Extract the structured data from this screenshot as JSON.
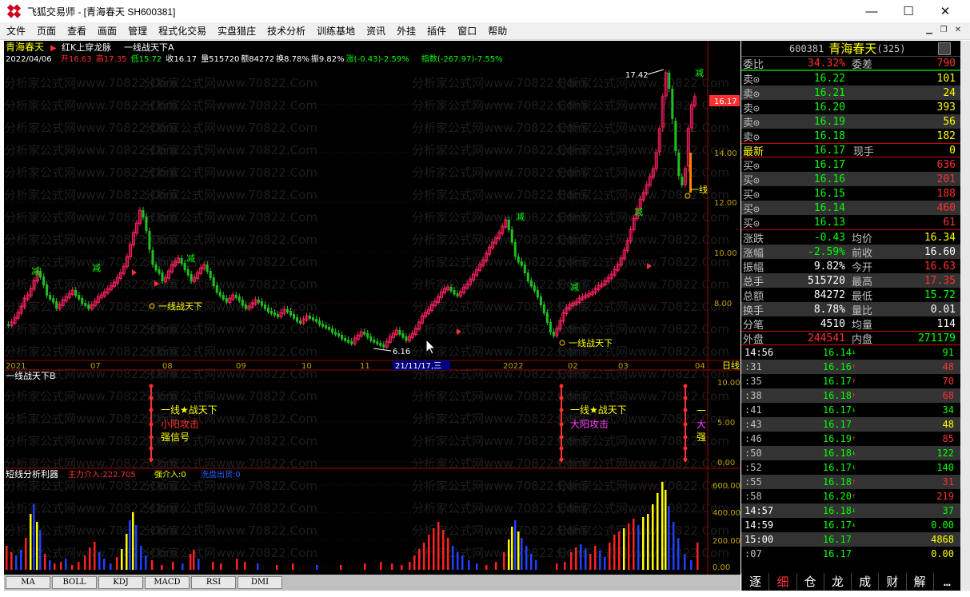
{
  "window": {
    "title": "飞狐交易师 - [青海春天 SH600381]"
  },
  "menu": [
    "文件",
    "页面",
    "查看",
    "画面",
    "管理",
    "程式化交易",
    "实盘猎庄",
    "技术分析",
    "训练基地",
    "资讯",
    "外挂",
    "插件",
    "窗口",
    "帮助"
  ],
  "chart_header": {
    "stock": "青海春天",
    "indicator1": "红K上穿龙脉",
    "indicator2": "一线战天下A",
    "date": "2022/04/06",
    "open": "开16.63",
    "high": "高17.35",
    "low": "低15.72",
    "close": "收16.17",
    "vol": "量515720",
    "amt": "额84272",
    "turnover": "换8.78%",
    "amp": "振9.82%",
    "change": "涨(-0.43)-2.59%",
    "index": "指数(-267.97)-7.55%"
  },
  "watermark": "分析家公式网www.70822.Com",
  "main_axis": [
    "16.17",
    "14.00",
    "12.00",
    "10.00",
    "8.00"
  ],
  "annotations": {
    "high": "17.42",
    "low": "6.16",
    "cursor_date": "21/11/17,三",
    "line_war": "一线战天下",
    "line_war_short": "一线",
    "reduce": "减"
  },
  "x_labels": [
    "2021",
    "07",
    "08",
    "09",
    "10",
    "11",
    "2022",
    "02",
    "03",
    "04"
  ],
  "period": "日线",
  "sub1": {
    "title": "一线战天下B",
    "axis": [
      "10.00",
      "5.00",
      "0.00"
    ],
    "labels": {
      "a": "一线★战天下",
      "b": "小阳攻击",
      "c": "强信号",
      "d": "大阳攻击",
      "e": "大",
      "f": "强"
    }
  },
  "sub2": {
    "title": "短线分析利器",
    "main": "主力介入:222.705",
    "strong": "强介入:0",
    "wash": "洗盘出货:0",
    "axis": [
      "600.00",
      "400.00",
      "200.00",
      "0.00"
    ]
  },
  "bottom_tabs": [
    "MA",
    "BOLL",
    "KDJ",
    "MACD",
    "RSI",
    "DMI"
  ],
  "quote": {
    "code": "600381",
    "name": "青海春天",
    "extra": "(325)",
    "weibi": {
      "label": "委比",
      "value": "34.32%",
      "label2": "委差",
      "value2": "790"
    },
    "asks": [
      {
        "l": "卖⊙",
        "p": "16.22",
        "v": "101"
      },
      {
        "l": "卖⊙",
        "p": "16.21",
        "v": "24"
      },
      {
        "l": "卖⊙",
        "p": "16.20",
        "v": "393"
      },
      {
        "l": "卖⊙",
        "p": "16.19",
        "v": "56"
      },
      {
        "l": "卖⊙",
        "p": "16.18",
        "v": "182"
      }
    ],
    "last": {
      "l": "最新",
      "p": "16.17",
      "l2": "现手",
      "v": "0"
    },
    "bids": [
      {
        "l": "买⊙",
        "p": "16.17",
        "v": "636"
      },
      {
        "l": "买⊙",
        "p": "16.16",
        "v": "201"
      },
      {
        "l": "买⊙",
        "p": "16.15",
        "v": "188"
      },
      {
        "l": "买⊙",
        "p": "16.14",
        "v": "460"
      },
      {
        "l": "买⊙",
        "p": "16.13",
        "v": "61"
      }
    ],
    "stats": [
      {
        "l": "涨跌",
        "v": "-0.43",
        "l2": "均价",
        "v2": "16.34"
      },
      {
        "l": "涨幅",
        "v": "-2.59%",
        "l2": "前收",
        "v2": "16.60"
      },
      {
        "l": "振幅",
        "v": "9.82%",
        "l2": "今开",
        "v2": "16.63"
      },
      {
        "l": "总手",
        "v": "515720",
        "l2": "最高",
        "v2": "17.35"
      },
      {
        "l": "总额",
        "v": "84272",
        "l2": "最低",
        "v2": "15.72"
      },
      {
        "l": "换手",
        "v": "8.78%",
        "l2": "量比",
        "v2": "0.01"
      },
      {
        "l": "分笔",
        "v": "4510",
        "l2": "均量",
        "v2": "114"
      }
    ],
    "waipan": {
      "l": "外盘",
      "v": "244541",
      "l2": "内盘",
      "v2": "271179"
    },
    "ticks": [
      {
        "t": "14:56",
        "p": "16.14",
        "a": "↓",
        "v": "91"
      },
      {
        "t": ":31",
        "p": "16.16",
        "a": "↑",
        "v": "48"
      },
      {
        "t": ":35",
        "p": "16.17",
        "a": "↑",
        "v": "70"
      },
      {
        "t": ":38",
        "p": "16.18",
        "a": "↑",
        "v": "68"
      },
      {
        "t": ":41",
        "p": "16.17",
        "a": "↓",
        "v": "34"
      },
      {
        "t": ":43",
        "p": "16.17",
        "a": "",
        "v": "48"
      },
      {
        "t": ":46",
        "p": "16.19",
        "a": "↑",
        "v": "85"
      },
      {
        "t": ":50",
        "p": "16.18",
        "a": "↓",
        "v": "122"
      },
      {
        "t": ":52",
        "p": "16.17",
        "a": "↓",
        "v": "140"
      },
      {
        "t": ":55",
        "p": "16.18",
        "a": "↑",
        "v": "31"
      },
      {
        "t": ":58",
        "p": "16.20",
        "a": "↑",
        "v": "219"
      },
      {
        "t": "14:57",
        "p": "16.18",
        "a": "↓",
        "v": "37"
      },
      {
        "t": "14:59",
        "p": "16.17",
        "a": "↓",
        "v": "0.00"
      },
      {
        "t": "15:00",
        "p": "16.17",
        "a": "",
        "v": "4868"
      },
      {
        "t": ":07",
        "p": "16.17",
        "a": "",
        "v": "0.00"
      }
    ],
    "tabs": [
      "逐",
      "细",
      "仓",
      "龙",
      "成",
      "财",
      "解",
      "…"
    ]
  }
}
